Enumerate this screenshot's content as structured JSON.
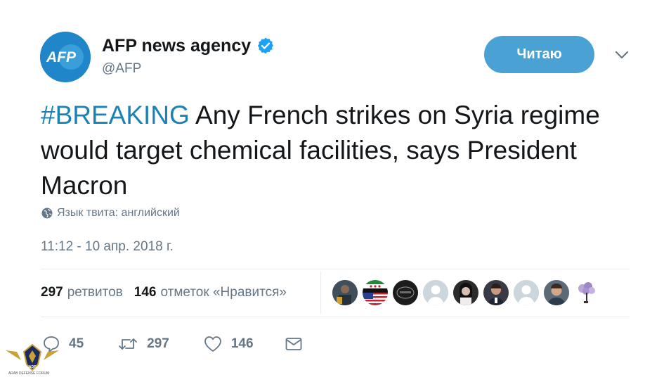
{
  "account": {
    "logo_text": "AFP",
    "display_name": "AFP news agency",
    "handle": "@AFP",
    "verified": true
  },
  "follow_button": {
    "label": "Читаю"
  },
  "tweet": {
    "hashtag": "#BREAKING",
    "text": " Any French strikes on Syria regime would target chemical facilities, says President Macron",
    "language_note": "Язык твита: английский",
    "timestamp": "11:12 - 10 апр. 2018 г."
  },
  "stats": {
    "retweets_count": "297",
    "retweets_label": "ретвитов",
    "likes_count": "146",
    "likes_label": "отметок «Нравится»"
  },
  "actions": {
    "replies": "45",
    "retweets": "297",
    "likes": "146"
  },
  "watermark": {
    "logo_text": "ADF",
    "lines": [
      "ARAB DEFENSE FORUM"
    ]
  },
  "colors": {
    "accent": "#1b82b7",
    "follow_button": "#4aa1d4",
    "verified": "#1da1f2",
    "muted": "#657786",
    "text": "#14171a",
    "avatar_bg": "#1f87c9"
  }
}
